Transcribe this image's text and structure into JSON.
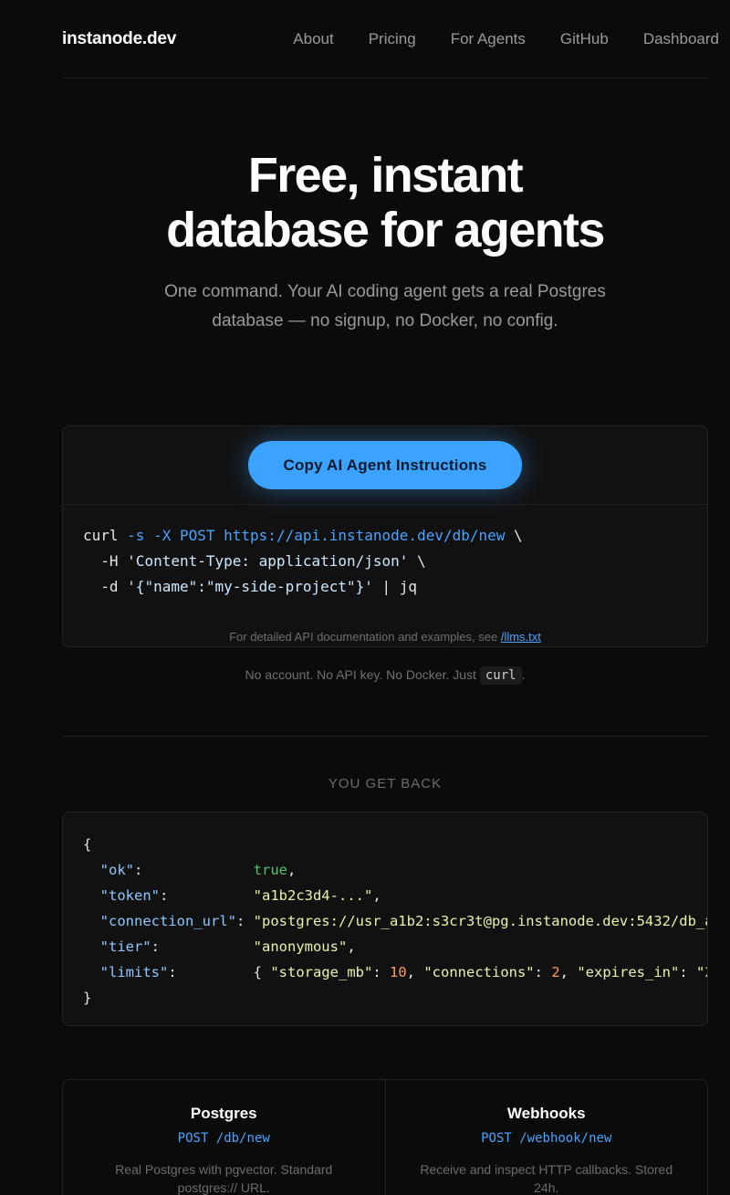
{
  "nav": {
    "logo": "instanode.dev",
    "links": [
      "About",
      "Pricing",
      "For Agents",
      "GitHub",
      "Dashboard"
    ]
  },
  "hero": {
    "title_line1": "Free, instant",
    "title_line2": "database for agents",
    "subtitle": "One command. Your AI coding agent gets a real Postgres database — no signup, no Docker, no config."
  },
  "install": {
    "button_label": "Copy AI Agent Instructions",
    "code": {
      "line1_cmd": "curl ",
      "line1_flags": "-s -X POST ",
      "line1_url": "https://api.instanode.dev/db/new",
      "line1_cont": " \\",
      "line2_flag": "  -H ",
      "line2_str": "'Content-Type: application/json'",
      "line2_cont": " \\",
      "line3_flag": "  -d ",
      "line3_str": "'{\"name\":\"my-side-project\"}'",
      "line3_pipe": " | jq"
    },
    "doc_note": "For detailed API documentation and examples, see ",
    "doc_link": "/llms.txt"
  },
  "tagline": {
    "text": "No account. No API key. No Docker. Just ",
    "code": "curl",
    "end": "."
  },
  "response": {
    "label": "YOU GET BACK",
    "open": "{",
    "close": "}",
    "rows": [
      {
        "key": "\"ok\"",
        "pad": ":             ",
        "value": "true",
        "type": "true",
        "tail": ","
      },
      {
        "key": "\"token\"",
        "pad": ":          ",
        "value": "\"a1b2c3d4-...\"",
        "type": "str",
        "tail": ","
      },
      {
        "key": "\"connection_url\"",
        "pad": ": ",
        "value": "\"postgres://usr_a1b2:s3cr3t@pg.instanode.dev:5432/db_a",
        "type": "str",
        "tail": ""
      },
      {
        "key": "\"tier\"",
        "pad": ":           ",
        "value": "\"anonymous\"",
        "type": "str",
        "tail": ","
      }
    ],
    "limits": {
      "key": "\"limits\"",
      "pad": ":         ",
      "open": "{ ",
      "k1": "\"storage_mb\"",
      "v1": "10",
      "k2": "\"connections\"",
      "v2": "2",
      "k3": "\"expires_in\"",
      "v3": "\"2"
    }
  },
  "features": [
    {
      "title": "Postgres",
      "endpoint": "POST /db/new",
      "desc": "Real Postgres with pgvector. Standard postgres:// URL."
    },
    {
      "title": "Webhooks",
      "endpoint": "POST /webhook/new",
      "desc": "Receive and inspect HTTP callbacks. Stored 24h."
    }
  ]
}
